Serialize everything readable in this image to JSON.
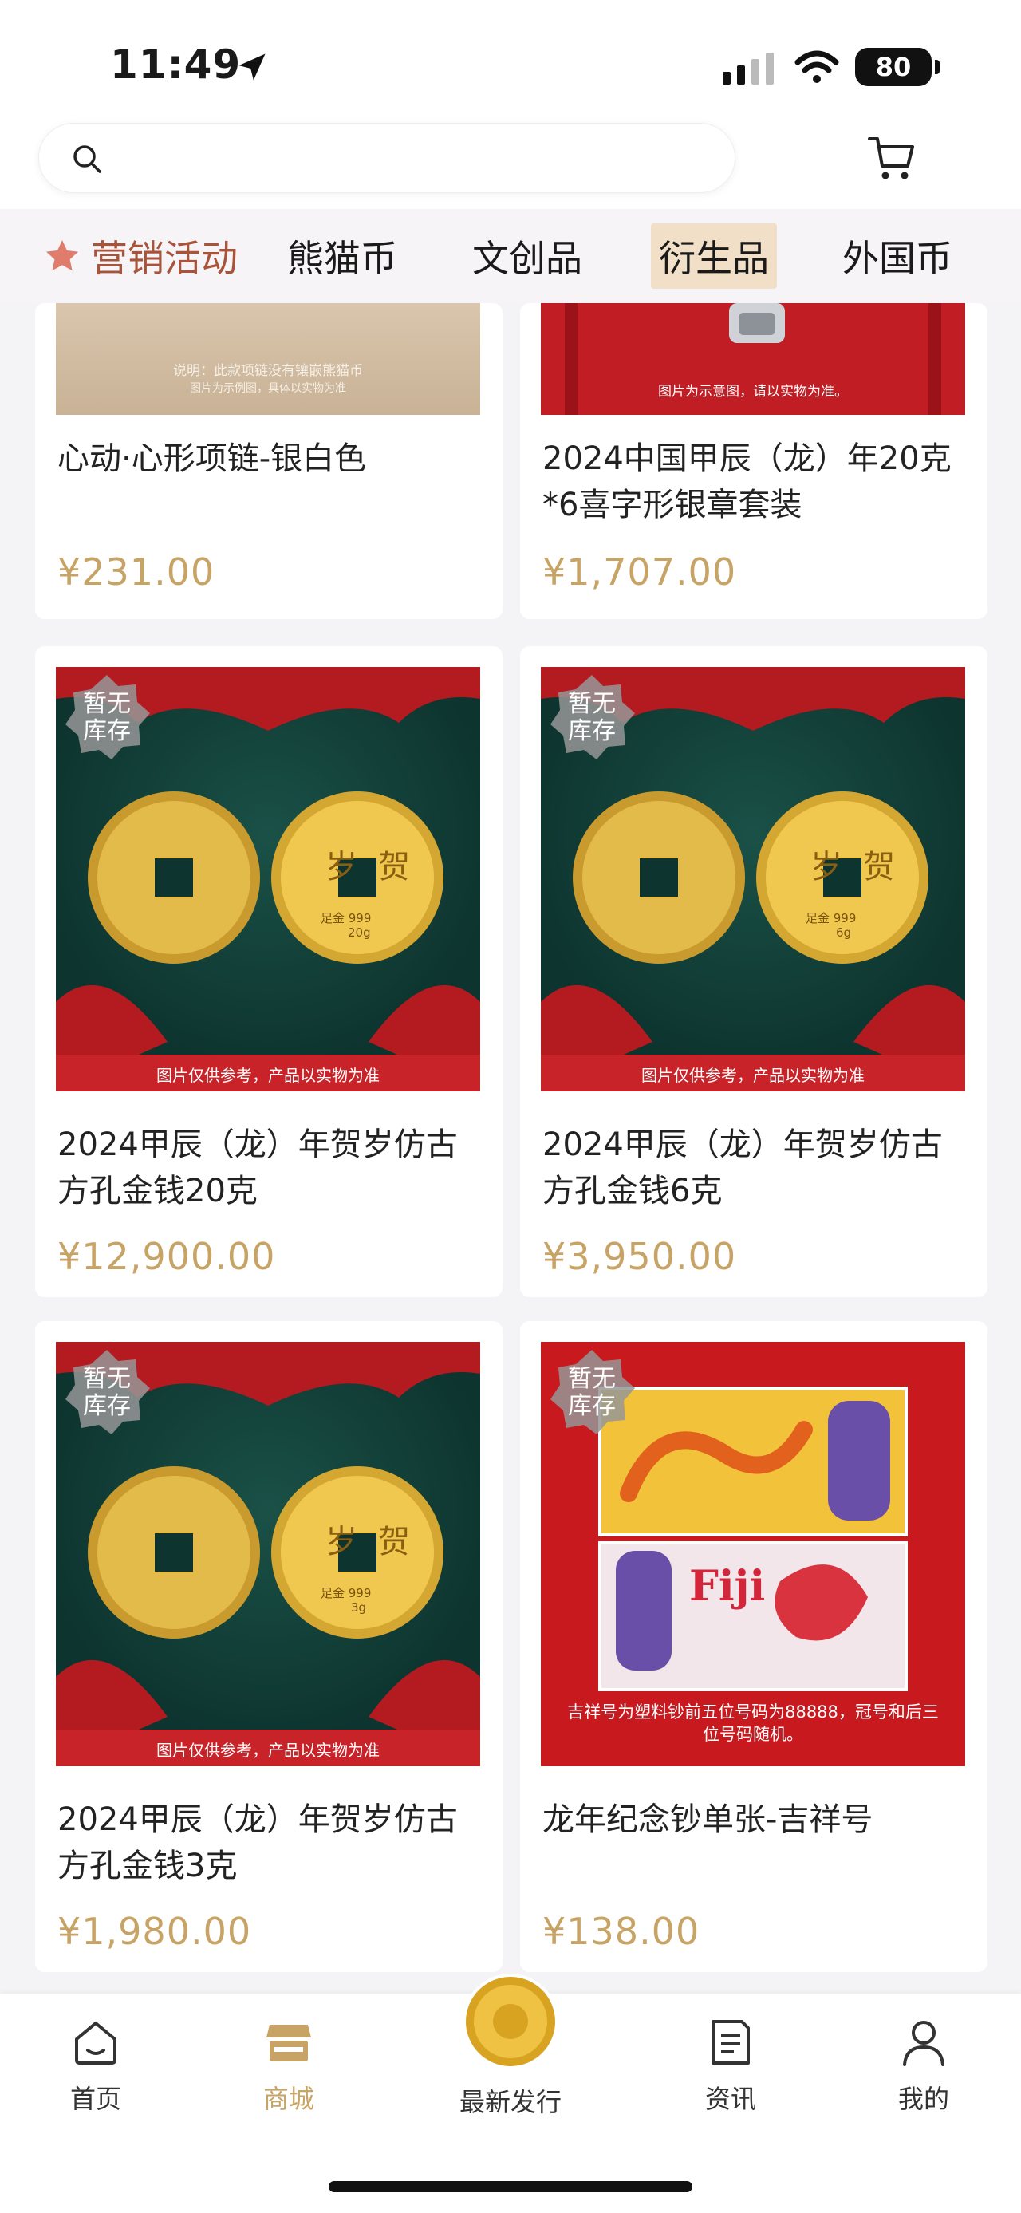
{
  "status_bar": {
    "time": "11:49",
    "battery": "80"
  },
  "search": {
    "placeholder": ""
  },
  "tabs": [
    {
      "label": "营销活动"
    },
    {
      "label": "熊猫币"
    },
    {
      "label": "文创品"
    },
    {
      "label": "衍生品",
      "active": true
    },
    {
      "label": "外国币"
    }
  ],
  "products": [
    {
      "title": "心动·心形项链-银白色",
      "price": "¥231.00",
      "image_caption": "说明：此款项链没有镶嵌熊猫币",
      "image_caption2": "图片为示例图，具体以实物为准"
    },
    {
      "title": "2024中国甲辰（龙）年20克*6喜字形银章套装",
      "price": "¥1,707.00",
      "image_caption": "图片为示意图，请以实物为准。"
    },
    {
      "title": "2024甲辰（龙）年贺岁仿古方孔金钱20克",
      "price": "¥12,900.00",
      "badge": "暂无库存",
      "coin_text": "足金 999",
      "coin_weight": "20g",
      "footer": "图片仅供参考，产品以实物为准"
    },
    {
      "title": "2024甲辰（龙）年贺岁仿古方孔金钱6克",
      "price": "¥3,950.00",
      "badge": "暂无库存",
      "coin_text": "足金 999",
      "coin_weight": "6g",
      "footer": "图片仅供参考，产品以实物为准"
    },
    {
      "title": "2024甲辰（龙）年贺岁仿古方孔金钱3克",
      "price": "¥1,980.00",
      "badge": "暂无库存",
      "coin_text": "足金 999",
      "coin_weight": "3g",
      "footer": "图片仅供参考，产品以实物为准"
    },
    {
      "title": "龙年纪念钞单张-吉祥号",
      "price": "¥138.00",
      "badge": "暂无库存",
      "note_label": "Fiji",
      "note_caption": "吉祥号为塑料钞前五位号码为88888，冠号和后三位号码随机。"
    }
  ],
  "bottom_nav": [
    {
      "label": "首页"
    },
    {
      "label": "商城",
      "active": true
    },
    {
      "label": "最新发行"
    },
    {
      "label": "资讯"
    },
    {
      "label": "我的"
    }
  ],
  "colors": {
    "accent_gold": "#c7a365",
    "tab_active_bg": "#f1dfc7",
    "marketing_red": "#a8543b",
    "card_red": "#b81c22",
    "card_green": "#0f3b34"
  }
}
